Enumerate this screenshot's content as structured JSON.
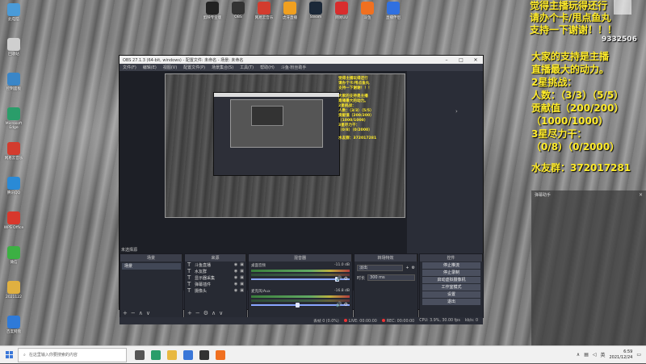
{
  "desktop": {
    "left_icons": [
      {
        "label": "此电脑",
        "color": "#4a9bd8"
      },
      {
        "label": "回收站",
        "color": "#cfcfcf"
      },
      {
        "label": "控制面板",
        "color": "#3a86c8"
      },
      {
        "label": "Microsoft Edge",
        "color": "#2a9d6a"
      },
      {
        "label": "网易云音乐",
        "color": "#d33c2e"
      },
      {
        "label": "腾讯QQ",
        "color": "#2a8ad6"
      },
      {
        "label": "WPS Office",
        "color": "#d8382c"
      },
      {
        "label": "微信",
        "color": "#3cb043"
      },
      {
        "label": "2021122",
        "color": "#e0b040"
      },
      {
        "label": "百度网盘",
        "color": "#2f7ad8"
      }
    ],
    "top_icons": [
      {
        "label": "剪映专业版",
        "color": "#222"
      },
      {
        "label": "OBS",
        "color": "#333"
      },
      {
        "label": "网易云音乐",
        "color": "#d33c2e"
      },
      {
        "label": "虎牙直播",
        "color": "#f0a020"
      },
      {
        "label": "Steam",
        "color": "#1b2838"
      },
      {
        "label": "网易UU",
        "color": "#d82d2d"
      },
      {
        "label": "斗鱼",
        "color": "#f07020"
      },
      {
        "label": "直播伴侣",
        "color": "#3070e0"
      }
    ]
  },
  "overlay": {
    "top_lines": [
      "觉得主播玩得还行",
      "请办个卡/甩点鱼丸",
      "支持一下谢谢！！！"
    ],
    "room_id": "9332506",
    "main_lines": [
      "大家的支持是主播",
      "直播最大的动力。",
      "2星挑战：",
      "人数：（3/3）（5/5）",
      "贡献值（200/200）",
      "（1000/1000）",
      "3星尽力干：",
      "（0/8）（0/2000）",
      "",
      "水友群：372017281"
    ]
  },
  "obs": {
    "title": "OBS 27.1.3 (64-bit, windows) - 配置文件: 未命名 - 场景: 未命名",
    "menu": [
      "文件(F)",
      "编辑(E)",
      "视图(V)",
      "配置文件(P)",
      "场景集合(S)",
      "工具(T)",
      "帮助(H)",
      "斗鱼·粉丝助手"
    ],
    "nested_overlay": [
      "觉得主播玩得还行",
      "请办个卡/甩点鱼丸",
      "支持一下谢谢！！！",
      "",
      "大家的支持是主播",
      "直播最大的动力。",
      "2星挑战：",
      "人数：（3/3）（5/5）",
      "贡献值（200/200）",
      "（1000/1000）",
      "3星尽力干：",
      "（0/8）（0/2000）",
      "",
      "水友群：372017281"
    ],
    "scenes_label": "未选择源",
    "panels": {
      "scenes": {
        "title": "场景",
        "items": [
          "场景"
        ]
      },
      "sources": {
        "title": "来源",
        "items": [
          "斗鱼直播",
          "水友群",
          "显示器采集",
          "弹幕插件",
          "摄像头"
        ]
      },
      "mixer": {
        "title": "混音器",
        "channels": [
          {
            "name": "桌面音频",
            "db": "-11.0 dB",
            "level": 0.85
          },
          {
            "name": "麦克风/Aux",
            "db": "-16.8 dB",
            "level": 0.45
          }
        ]
      },
      "transitions": {
        "title": "转场特效",
        "type": "淡出",
        "duration_label": "时长",
        "duration": "300 ms"
      },
      "controls": {
        "title": "控件",
        "buttons": [
          "停止推流",
          "停止录制",
          "启动虚拟摄像机",
          "工作室模式",
          "设置",
          "退出"
        ]
      }
    },
    "status": {
      "dropped": "丢帧 0 (0.0%)",
      "live": "LIVE: 00:00:00",
      "rec": "REC: 00:00:00",
      "cpu": "CPU: 3.9%, 30.00 fps",
      "kbps": "kb/s: 0"
    }
  },
  "chat": {
    "title": "弹幕助手",
    "close": "×"
  },
  "taskbar": {
    "search_placeholder": "在这里输入你要搜索的内容",
    "apps": [
      {
        "name": "task-view",
        "color": "#555"
      },
      {
        "name": "edge",
        "color": "#2a9d6a"
      },
      {
        "name": "file-explorer",
        "color": "#e8b840"
      },
      {
        "name": "store",
        "color": "#3a77d8"
      },
      {
        "name": "obs",
        "color": "#333"
      },
      {
        "name": "douyu",
        "color": "#f07020"
      }
    ],
    "time": "6:59",
    "date": "2021/12/24",
    "lang": "英"
  }
}
